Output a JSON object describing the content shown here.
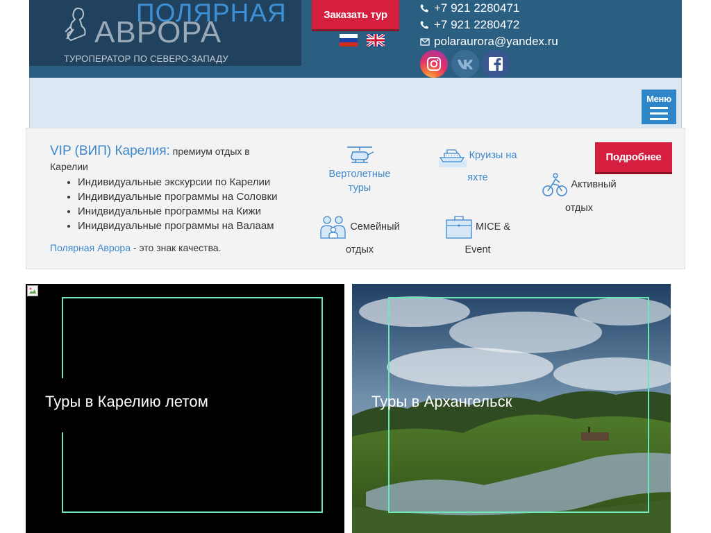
{
  "header": {
    "logo_line1": "ПОЛЯРНАЯ",
    "logo_line2": "АВРОРА",
    "tagline": "ТУРОПЕРАТОР ПО СЕВЕРО-ЗАПАДУ",
    "order_button": "Заказать тур",
    "languages": [
      "ru",
      "en"
    ],
    "phone1": "+7 921 2280471",
    "phone2": "+7 921 2280472",
    "email": "polaraurora@yandex.ru",
    "social": [
      "instagram-icon",
      "vk-icon",
      "facebook-icon"
    ]
  },
  "navbar": {
    "menu_label": "Меню"
  },
  "vip": {
    "title": "VIP (ВИП) Карелия:",
    "subtitle": " премиум отдых в Карелии",
    "items": [
      "Индивидуальные экскурсии по Карелии",
      "Индивидуальные программы на Соловки",
      "Инидвидуальные программы на Кижи",
      "Инидвидуальные программы на Валаам"
    ],
    "foot_link": "Полярная Аврора",
    "foot_text": " - это знак качества.",
    "features": {
      "heli": "Вертолетные туры",
      "cruise_a": "Круизы на",
      "cruise_b": "яхте",
      "active_a": "Активный",
      "active_b": "отдых",
      "family_a": "Семейный",
      "family_b": "отдых",
      "mice_a": "MICE &",
      "mice_b": "Event"
    },
    "more_button": "Подробнее"
  },
  "cards": [
    {
      "title": "Туры в Карелию летом"
    },
    {
      "title": "Туры в Архангельск"
    }
  ],
  "colors": {
    "header_bg": "#2a5f82",
    "accent_red": "#d61f3f",
    "link_blue": "#3d87cc",
    "frame_green": "#6fe6b8"
  }
}
